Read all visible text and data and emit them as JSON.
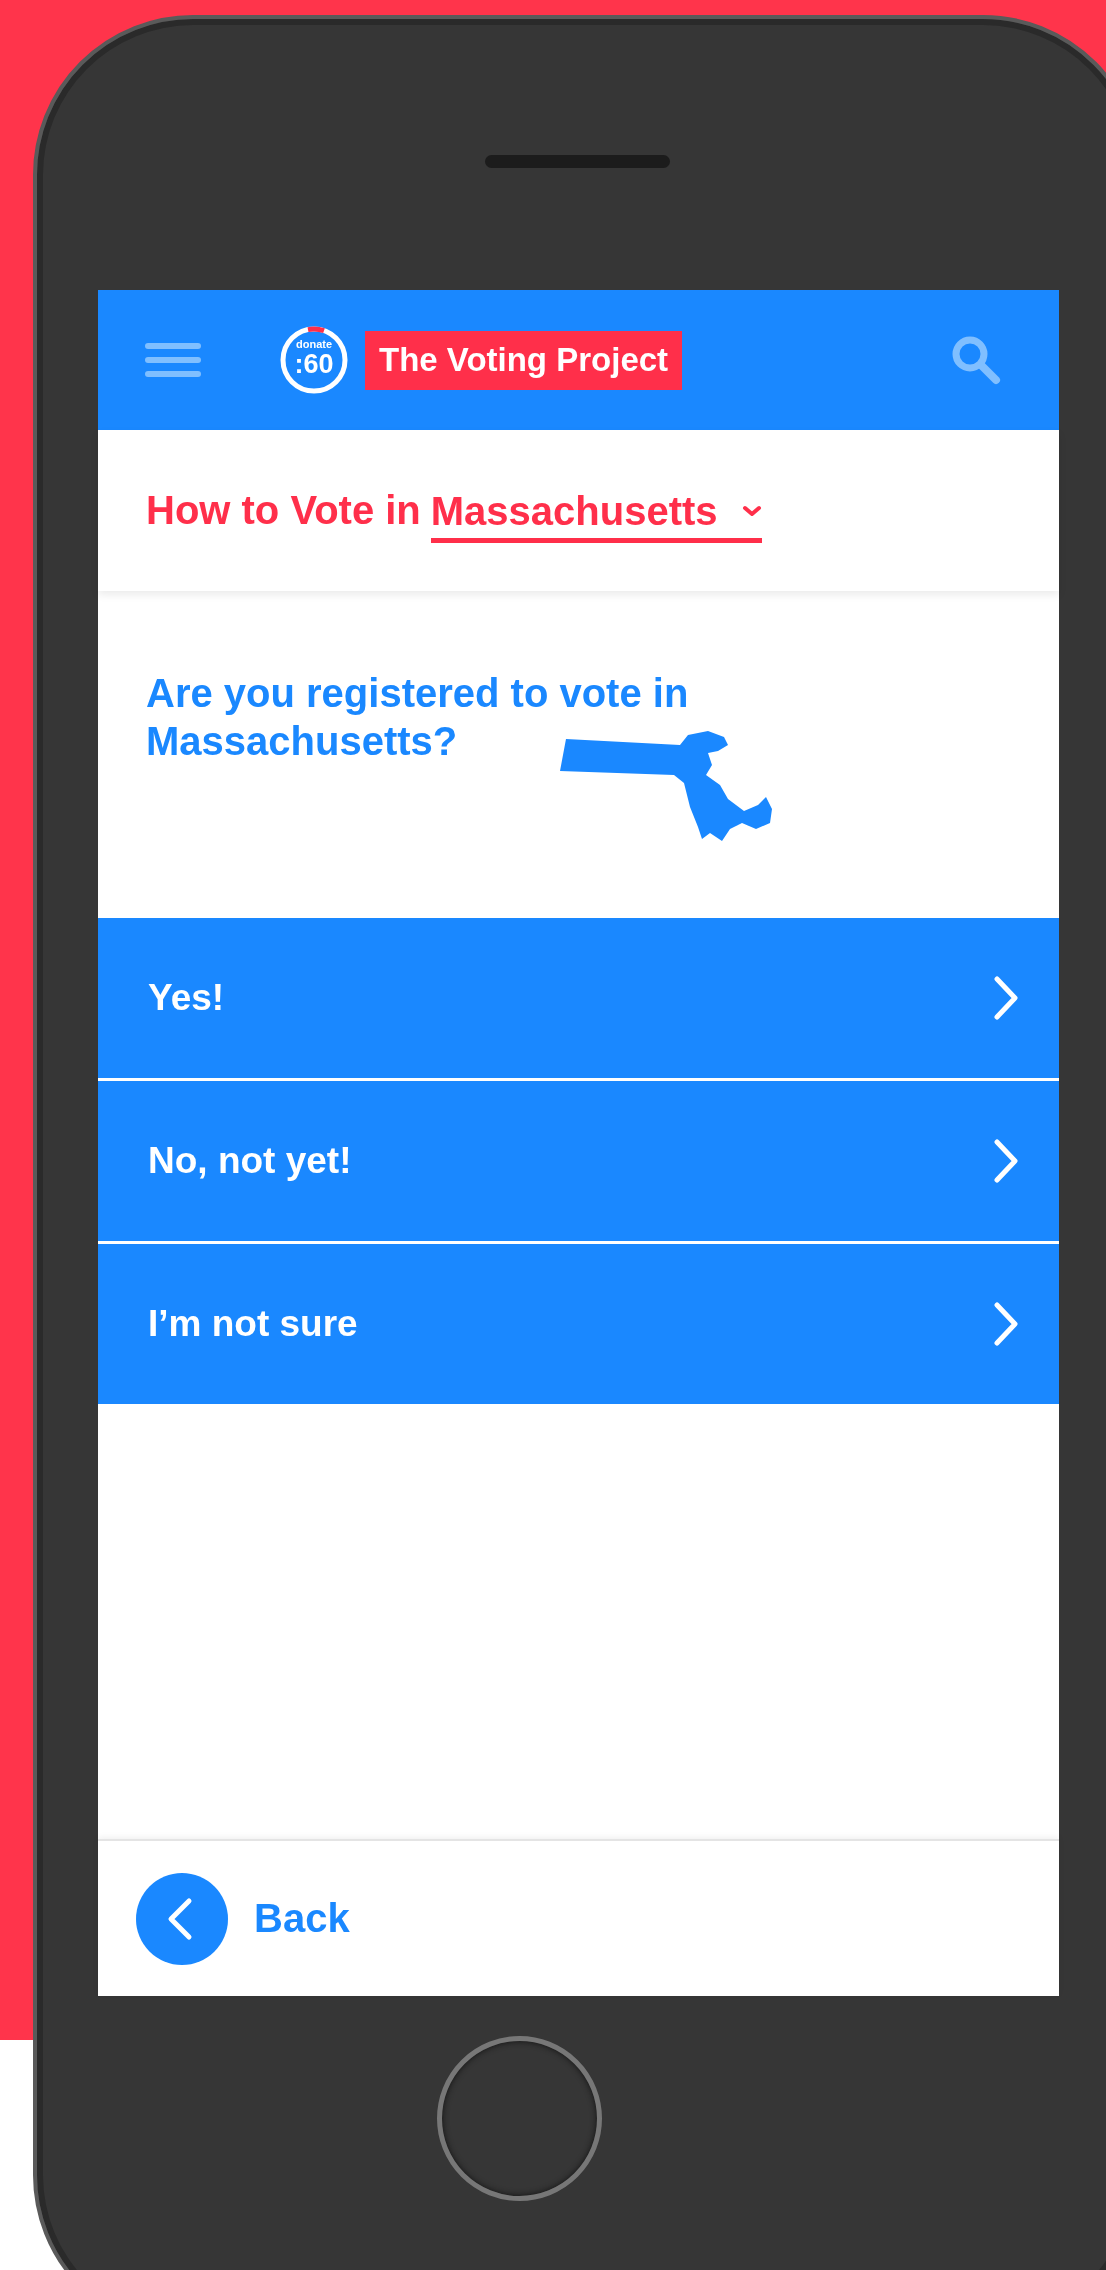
{
  "header": {
    "logo_small": "donate",
    "logo_big": ":60",
    "site_title": "The Voting Project"
  },
  "title": {
    "prefix": "How to Vote in",
    "state": "Massachusetts"
  },
  "question": "Are you registered to vote in Massachusetts?",
  "options": [
    {
      "label": "Yes!"
    },
    {
      "label": "No, not yet!"
    },
    {
      "label": "I’m not sure"
    }
  ],
  "back": {
    "label": "Back"
  }
}
